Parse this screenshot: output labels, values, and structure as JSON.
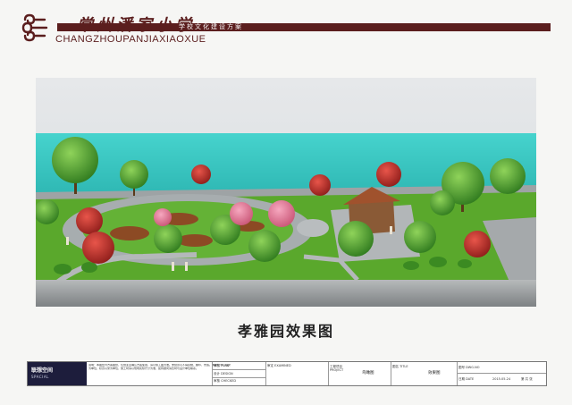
{
  "header": {
    "title_cn": "常州潘家小学",
    "subtitle_cn": "学校文化建设方案",
    "title_en": "CHANGZHOUPANJIAXIAOXUE"
  },
  "render": {
    "caption": "孝雅园效果图"
  },
  "title_block": {
    "company_cn": "联想空间",
    "company_en": "SPACIAL",
    "notes": "说明：本图纸为方案图纸，仅供业主确认方案使用，请以施工图为准。未经许可不得复制、翻印、仿造。本图尺寸以毫米为单位，标高以米为单位，施工时请以现场实际尺寸为准，如有疑问请及时与设计单位联系。",
    "plan_label": "审核 PLAN",
    "design_label": "设计 DESIGN",
    "checked_label": "审核 CHECKED",
    "examined_label": "审定 EXAMINED",
    "project_label": "工程项目 PROJECT",
    "project_value": "鸟瞰图",
    "title_label": "图名 TITLE",
    "title_value": "效果图",
    "dwg_label": "图号 DWG.NO",
    "date_label": "日期 DATE",
    "date_value": "2015.05.24",
    "page_label": "第  共 张"
  },
  "colors": {
    "brand": "#5b1e1e",
    "sky": "#dfe3e6",
    "water": "#3ec7c2",
    "lawn": "#5fae2e",
    "path": "#a9aeb0"
  }
}
